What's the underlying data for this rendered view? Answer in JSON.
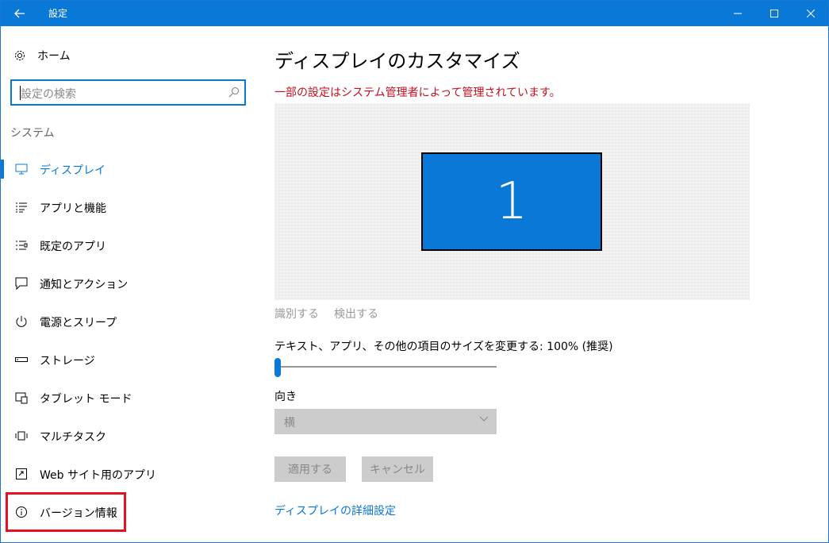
{
  "window": {
    "title": "設定"
  },
  "sidebar": {
    "home_label": "ホーム",
    "search_placeholder": "設定の検索",
    "section_label": "システム",
    "items": [
      {
        "label": "ディスプレイ",
        "icon": "display-icon",
        "active": true
      },
      {
        "label": "アプリと機能",
        "icon": "apps-list-icon"
      },
      {
        "label": "既定のアプリ",
        "icon": "default-apps-icon"
      },
      {
        "label": "通知とアクション",
        "icon": "notification-icon"
      },
      {
        "label": "電源とスリープ",
        "icon": "power-icon"
      },
      {
        "label": "ストレージ",
        "icon": "storage-icon"
      },
      {
        "label": "タブレット モード",
        "icon": "tablet-icon"
      },
      {
        "label": "マルチタスク",
        "icon": "multitask-icon"
      },
      {
        "label": "Web サイト用のアプリ",
        "icon": "web-apps-icon"
      },
      {
        "label": "バージョン情報",
        "icon": "info-icon"
      }
    ]
  },
  "main": {
    "title": "ディスプレイのカスタマイズ",
    "warning": "一部の設定はシステム管理者によって管理されています。",
    "monitor_number": "1",
    "identify_link": "識別する",
    "detect_link": "検出する",
    "scale_label": "テキスト、アプリ、その他の項目のサイズを変更する: 100% (推奨)",
    "scale_value": 100,
    "orientation_label": "向き",
    "orientation_value": "横",
    "apply_button": "適用する",
    "cancel_button": "キャンセル",
    "advanced_link": "ディスプレイの詳細設定"
  },
  "colors": {
    "accent": "#0a78d7",
    "warning": "#c50f1f",
    "highlight": "#e81123"
  }
}
